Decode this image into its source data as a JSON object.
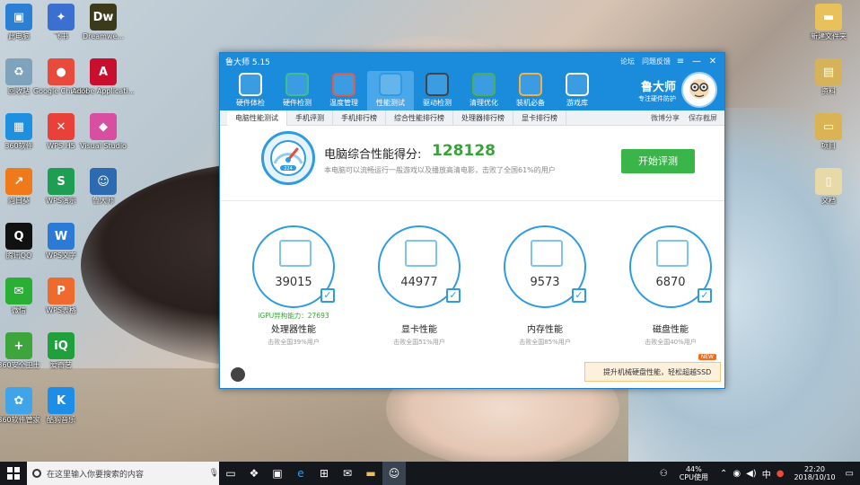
{
  "desktop": {
    "left_icons": [
      {
        "label": "此电脑",
        "glyph": "▣",
        "color": "#2b7fd4"
      },
      {
        "label": "飞书",
        "glyph": "✦",
        "color": "#3b6fd0"
      },
      {
        "label": "Dreamwe...",
        "glyph": "Dw",
        "color": "#3b3b1b"
      },
      {
        "label": "回收站",
        "glyph": "♻",
        "color": "#7fa3bd"
      },
      {
        "label": "Google Chrome",
        "glyph": "●",
        "color": "#e84b3c"
      },
      {
        "label": "Adobe Applicati...",
        "glyph": "A",
        "color": "#c8102e"
      },
      {
        "label": "360软件",
        "glyph": "▦",
        "color": "#1f8fe0"
      },
      {
        "label": "WPS H5",
        "glyph": "✕",
        "color": "#e8413a"
      },
      {
        "label": "Visual Studio",
        "glyph": "◆",
        "color": "#d84ea0"
      },
      {
        "label": "向日葵",
        "glyph": "↗",
        "color": "#f07a1a"
      },
      {
        "label": "WPS演示",
        "glyph": "S",
        "color": "#1e9e52"
      },
      {
        "label": "鲁大师",
        "glyph": "☺",
        "color": "#2d6ab0"
      },
      {
        "label": "腾讯QQ",
        "glyph": "Q",
        "color": "#111111"
      },
      {
        "label": "WPS文字",
        "glyph": "W",
        "color": "#2b7bd6"
      },
      {
        "label": "",
        "glyph": "",
        "color": ""
      },
      {
        "label": "微信",
        "glyph": "✉",
        "color": "#2aae34"
      },
      {
        "label": "WPS表格",
        "glyph": "P",
        "color": "#ee6a2d"
      },
      {
        "label": "",
        "glyph": "",
        "color": ""
      },
      {
        "label": "360安全卫士",
        "glyph": "+",
        "color": "#3ca53c"
      },
      {
        "label": "爱奇艺",
        "glyph": "iQ",
        "color": "#1fa03c"
      },
      {
        "label": "",
        "glyph": "",
        "color": ""
      },
      {
        "label": "360软件管家",
        "glyph": "✿",
        "color": "#3fa5e8"
      },
      {
        "label": "酷狗音乐",
        "glyph": "K",
        "color": "#1c8ee8"
      }
    ],
    "right_icons": [
      {
        "label": "新建文件夹",
        "glyph": "▬",
        "color": "#e8c15a"
      },
      {
        "label": "资料",
        "glyph": "▤",
        "color": "#d6b35a"
      },
      {
        "label": "项目",
        "glyph": "▭",
        "color": "#d9b354"
      },
      {
        "label": "文档",
        "glyph": "▯",
        "color": "#e7d9a8"
      }
    ]
  },
  "window": {
    "title": "鲁大师 5.15",
    "title_links": [
      "论坛",
      "问题反馈"
    ],
    "controls": [
      "≡",
      "—",
      "✕"
    ],
    "tools": [
      {
        "label": "硬件体检",
        "color": "#ffffff",
        "active": false
      },
      {
        "label": "硬件检测",
        "color": "#3cbf8b",
        "active": false
      },
      {
        "label": "温度管理",
        "color": "#e65a4a",
        "active": false
      },
      {
        "label": "性能测试",
        "color": "#2f9be2",
        "active": true
      },
      {
        "label": "驱动检测",
        "color": "#444444",
        "active": false
      },
      {
        "label": "清理优化",
        "color": "#4caf50",
        "active": false
      },
      {
        "label": "装机必备",
        "color": "#f5b041",
        "active": false
      },
      {
        "label": "游戏库",
        "color": "#ffffff",
        "active": false
      }
    ],
    "brand": {
      "name": "鲁大师",
      "slogan": "专注硬件防护"
    },
    "subtabs": [
      {
        "label": "电脑性能测试",
        "active": true
      },
      {
        "label": "手机评测",
        "active": false
      },
      {
        "label": "手机排行榜",
        "active": false
      },
      {
        "label": "综合性能排行榜",
        "active": false
      },
      {
        "label": "处理器排行榜",
        "active": false
      },
      {
        "label": "显卡排行榜",
        "active": false
      }
    ],
    "share": [
      "微博分享",
      "保存截屏"
    ],
    "score": {
      "title": "电脑综合性能得分:",
      "value": "128128",
      "gauge_text": "224",
      "note": "本电脑可以流畅运行一般游戏以及播放高清电影，击败了全国61%的用户"
    },
    "start_button": "开始评测",
    "cards": [
      {
        "value": "39015",
        "extra": "iGPU异构能力：27693",
        "name": "处理器性能",
        "pct": "击败全国39%用户"
      },
      {
        "value": "44977",
        "extra": "",
        "name": "显卡性能",
        "pct": "击败全国51%用户"
      },
      {
        "value": "9573",
        "extra": "",
        "name": "内存性能",
        "pct": "击败全国85%用户"
      },
      {
        "value": "6870",
        "extra": "",
        "name": "磁盘性能",
        "pct": "击败全国40%用户"
      }
    ],
    "promo": {
      "text": "提升机械硬盘性能，轻松超越SSD",
      "badge": "NEW"
    }
  },
  "taskbar": {
    "search_placeholder": "在这里输入你要搜索的内容",
    "cpu": "44%",
    "cpu_label": "CPU使用",
    "time": "22:20",
    "date": "2018/10/10",
    "lang": "中"
  }
}
